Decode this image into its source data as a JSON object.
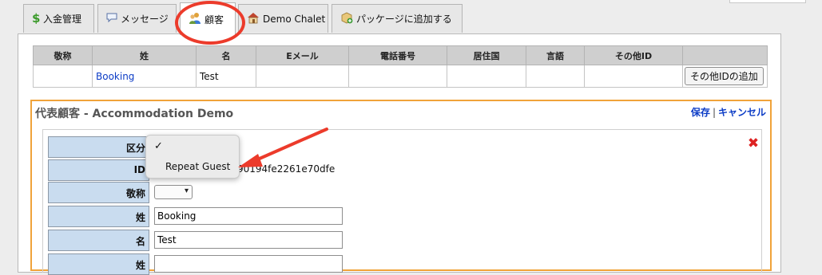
{
  "tabs": [
    {
      "label": "入金管理",
      "icon": "dollar-icon"
    },
    {
      "label": "メッセージ",
      "icon": "speech-bubble-icon"
    },
    {
      "label": "顧客",
      "icon": "people-icon"
    },
    {
      "label": "Demo Chalet",
      "icon": "house-icon"
    },
    {
      "label": "パッケージに追加する",
      "icon": "package-add-icon"
    }
  ],
  "guest_table": {
    "headers": [
      "敬称",
      "姓",
      "名",
      "Eメール",
      "電話番号",
      "居住国",
      "言語",
      "その他ID"
    ],
    "row": {
      "title": "",
      "last_name": "Booking",
      "first_name": "Test",
      "email": "",
      "phone": "",
      "country": "",
      "language": "",
      "other_id": ""
    },
    "add_other_id_button": "その他IDの追加"
  },
  "rep_guest": {
    "title": "代表顧客 - Accommodation Demo",
    "save": "保存",
    "separator": "|",
    "cancel": "キャンセル",
    "fields": {
      "category_label": "区分",
      "id_label": "ID",
      "id_value": "90194fe2261e70dfe",
      "salutation_label": "敬称",
      "last_name_label": "姓",
      "last_name_value": "Booking",
      "first_name_label": "名",
      "first_name_value": "Test",
      "next_label": "姓"
    }
  },
  "category_dropdown": {
    "checkmark": "✓",
    "options": [
      "",
      "Repeat Guest"
    ]
  },
  "colors": {
    "highlight_circle": "#ec3b2b",
    "arrow": "#ec3b2b",
    "rep_border": "#f0a33a",
    "link": "#0c3cc6",
    "label_bg": "#c9dcef"
  }
}
